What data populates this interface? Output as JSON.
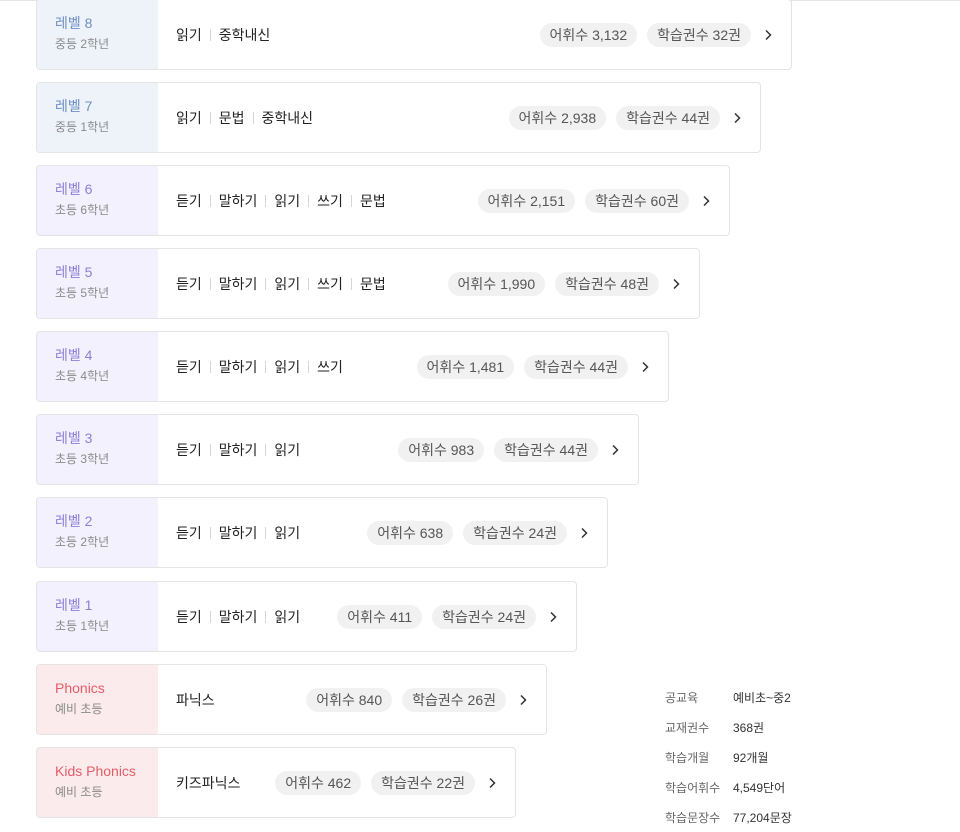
{
  "levels": [
    {
      "title": "레벨 8",
      "sub": "중등 2학년",
      "skills": [
        "읽기",
        "중학내신"
      ],
      "vocab": "어휘수 3,132",
      "books": "학습권수 32권"
    },
    {
      "title": "레벨 7",
      "sub": "중등 1학년",
      "skills": [
        "읽기",
        "문법",
        "중학내신"
      ],
      "vocab": "어휘수 2,938",
      "books": "학습권수 44권"
    },
    {
      "title": "레벨 6",
      "sub": "초등 6학년",
      "skills": [
        "듣기",
        "말하기",
        "읽기",
        "쓰기",
        "문법"
      ],
      "vocab": "어휘수 2,151",
      "books": "학습권수 60권"
    },
    {
      "title": "레벨 5",
      "sub": "초등 5학년",
      "skills": [
        "듣기",
        "말하기",
        "읽기",
        "쓰기",
        "문법"
      ],
      "vocab": "어휘수 1,990",
      "books": "학습권수 48권"
    },
    {
      "title": "레벨 4",
      "sub": "초등 4학년",
      "skills": [
        "듣기",
        "말하기",
        "읽기",
        "쓰기"
      ],
      "vocab": "어휘수 1,481",
      "books": "학습권수 44권"
    },
    {
      "title": "레벨 3",
      "sub": "초등 3학년",
      "skills": [
        "듣기",
        "말하기",
        "읽기"
      ],
      "vocab": "어휘수 983",
      "books": "학습권수 44권"
    },
    {
      "title": "레벨 2",
      "sub": "초등 2학년",
      "skills": [
        "듣기",
        "말하기",
        "읽기"
      ],
      "vocab": "어휘수 638",
      "books": "학습권수 24권"
    },
    {
      "title": "레벨 1",
      "sub": "초등 1학년",
      "skills": [
        "듣기",
        "말하기",
        "읽기"
      ],
      "vocab": "어휘수 411",
      "books": "학습권수 24권"
    },
    {
      "title": "Phonics",
      "sub": "예비 초등",
      "skills": [
        "파닉스"
      ],
      "vocab": "어휘수 840",
      "books": "학습권수 26권"
    },
    {
      "title": "Kids Phonics",
      "sub": "예비 초등",
      "skills": [
        "키즈파닉스"
      ],
      "vocab": "어휘수 462",
      "books": "학습권수 22권"
    }
  ],
  "stats": [
    {
      "label": "공교육",
      "value": "예비초~중2"
    },
    {
      "label": "교재권수",
      "value": "368권"
    },
    {
      "label": "학습개월",
      "value": "92개월"
    },
    {
      "label": "학습어휘수",
      "value": "4,549단어"
    },
    {
      "label": "학습문장수",
      "value": "77,204문장"
    }
  ],
  "icons": {
    "chevron": "chevron-right-icon"
  },
  "colors": {
    "middle_school": "#6d8fc4",
    "elementary": "#8d7fd6",
    "phonics": "#e35d67"
  }
}
